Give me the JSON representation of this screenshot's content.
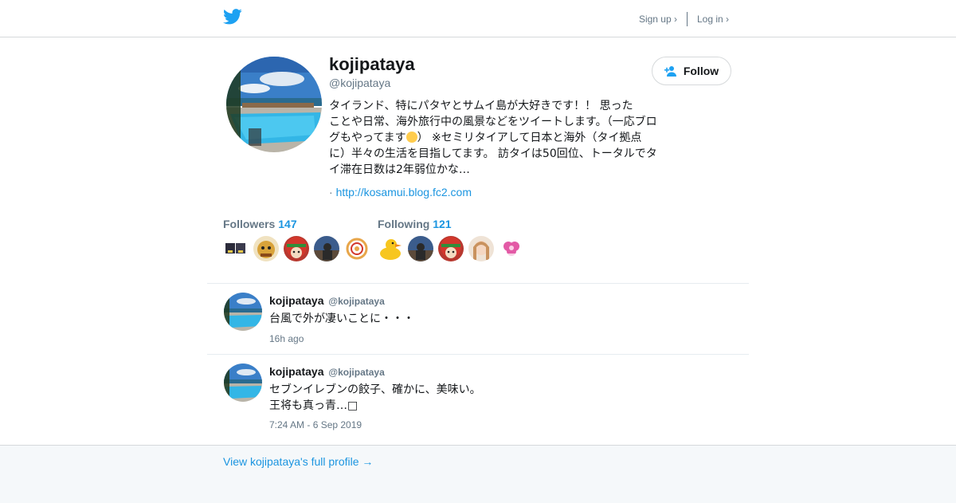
{
  "nav": {
    "signup": "Sign up ›",
    "login": "Log in ›"
  },
  "profile": {
    "name": "kojipataya",
    "handle": "@kojipataya",
    "follow_label": "Follow",
    "bio_lines": [
      "タイランド、特にパタヤとサムイ島が大好きです！！ 思った",
      "ことや日常、海外旅行中の風景などをツイートします。（一応ブロ",
      "グもやってます",
      "） ※セミリタイアして日本と海外（タイ拠点",
      "に）半々の生活を目指してます。 訪タイは50回位、トータルでタ",
      "イ滞在日数は2年弱位かな…"
    ],
    "url_prefix": "· ",
    "url": "http://kosamui.blog.fc2.com"
  },
  "followers": {
    "label": "Followers",
    "count": "147"
  },
  "following": {
    "label": "Following",
    "count": "121"
  },
  "tweets": [
    {
      "name": "kojipataya",
      "handle": "@kojipataya",
      "text": "台風で外が凄いことに・・・",
      "time": "16h ago"
    },
    {
      "name": "kojipataya",
      "handle": "@kojipataya",
      "text_line1": "セブンイレブンの餃子、確かに、美味い。",
      "text_line2": "王将も真っ青…□",
      "time": "7:24 AM - 6 Sep 2019"
    }
  ],
  "footer": {
    "link": "View kojipataya's full profile →"
  },
  "colors": {
    "accent": "#1b95e0",
    "twitter_blue": "#1da1f2",
    "muted": "#657786"
  }
}
